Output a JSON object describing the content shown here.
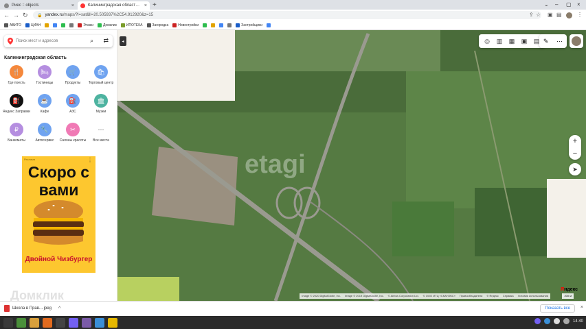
{
  "browser": {
    "tabs": [
      {
        "title": "Риес :: objects",
        "close": "×"
      },
      {
        "title": "Калининградская област…",
        "close": "×"
      }
    ],
    "new_tab": "+",
    "window_controls": [
      "⌄",
      "–",
      "▢",
      "×"
    ],
    "url": "yandex.ru/maps/?l=sat&ll=20.505937%2C54.912920&z=15",
    "url_host": "yandex.ru",
    "url_rest": "/maps/?l=sat&ll=20.505937%2C54.912920&z=15",
    "bookmarks": [
      {
        "label": "АВИТО",
        "color": "#555555"
      },
      {
        "label": "ЦИАН",
        "color": "#1a5dc8"
      },
      {
        "label": "",
        "color": "#e2a400"
      },
      {
        "label": "",
        "color": "#4285f4"
      },
      {
        "label": "",
        "color": "#2dbd4e"
      },
      {
        "label": "",
        "color": "#777777"
      },
      {
        "label": "Этажи",
        "color": "#cc2222"
      },
      {
        "label": "Домклик",
        "color": "#2dbd4e"
      },
      {
        "label": "ИПОТЕКА",
        "color": "#7a9c2a"
      },
      {
        "label": "Загородка",
        "color": "#555555"
      },
      {
        "label": "Новостройки",
        "color": "#cc2222"
      },
      {
        "label": "",
        "color": "#2dbd4e"
      },
      {
        "label": "",
        "color": "#e2a400"
      },
      {
        "label": "",
        "color": "#4285f4"
      },
      {
        "label": "",
        "color": "#777777"
      },
      {
        "label": "Застройщики",
        "color": "#1a5dc8"
      },
      {
        "label": "",
        "color": "#4285f4"
      }
    ]
  },
  "sidebar": {
    "search_placeholder": "Поиск мест и адресов",
    "region_title": "Калининградская область",
    "categories": [
      {
        "label": "Где поесть",
        "color": "#f5883c",
        "glyph": "🍴"
      },
      {
        "label": "Гостиницы",
        "color": "#b58ee0",
        "glyph": "🛏"
      },
      {
        "label": "Продукты",
        "color": "#6fa3f0",
        "glyph": "🛒"
      },
      {
        "label": "Торговый центр",
        "color": "#6fa3f0",
        "glyph": "🛍"
      },
      {
        "label": "Яндекс Заправки",
        "color": "#111111",
        "glyph": "⛽"
      },
      {
        "label": "Кафе",
        "color": "#6fa3f0",
        "glyph": "☕"
      },
      {
        "label": "АЗС",
        "color": "#6fa3f0",
        "glyph": "⛽"
      },
      {
        "label": "Музеи",
        "color": "#4db3a0",
        "glyph": "🏛"
      },
      {
        "label": "Банкоматы",
        "color": "#b58ee0",
        "glyph": "₽"
      },
      {
        "label": "Автосервис",
        "color": "#6fa3f0",
        "glyph": "🔧"
      },
      {
        "label": "Салоны красоты",
        "color": "#f07ab5",
        "glyph": "✂"
      },
      {
        "label": "Все места",
        "color": "#ffffff",
        "glyph": "⋯"
      }
    ],
    "ad": {
      "label": "Реклама",
      "menu": "⋮",
      "headline": "Скоро с вами",
      "footer": "Двойной Чизбургер"
    }
  },
  "map": {
    "collapse_glyph": "◂",
    "watermark": "etagi",
    "toolbar_icons": [
      "layers-icon",
      "panorama-icon",
      "traffic-icon",
      "transport-icon",
      "parking-icon"
    ],
    "toolbar2_icons": [
      "ruler-icon",
      "more-icon"
    ],
    "zoom_in": "+",
    "zoom_out": "−",
    "locate": "➤",
    "copyright_items": [
      "Image © 2020 DigitalGlobe, Inc.",
      "Image © 2019 DigitalGlobe, Inc.",
      "© Airbus Corporation Ltd.",
      "© ООО ИТЦ «СКАНЭКС»",
      "Правообладатели",
      "© Яндекс",
      "Справка",
      "Условия использования"
    ],
    "scale_label": "200 м",
    "logo_first": "Я",
    "logo_rest": "ндекс",
    "domclick_watermark": "Домклик"
  },
  "downloads": {
    "filename": "Школа в Прав....jpeg",
    "chevron": "^",
    "show_all": "Показать все",
    "close": "×"
  },
  "taskbar": {
    "time": "14:40",
    "apps": [
      "#3a3a3a",
      "#4a8f3a",
      "#d9a03c",
      "#e26b1f",
      "#444",
      "#7360f2",
      "#7b5ba8",
      "#3b8fd8",
      "#e6b800"
    ]
  }
}
